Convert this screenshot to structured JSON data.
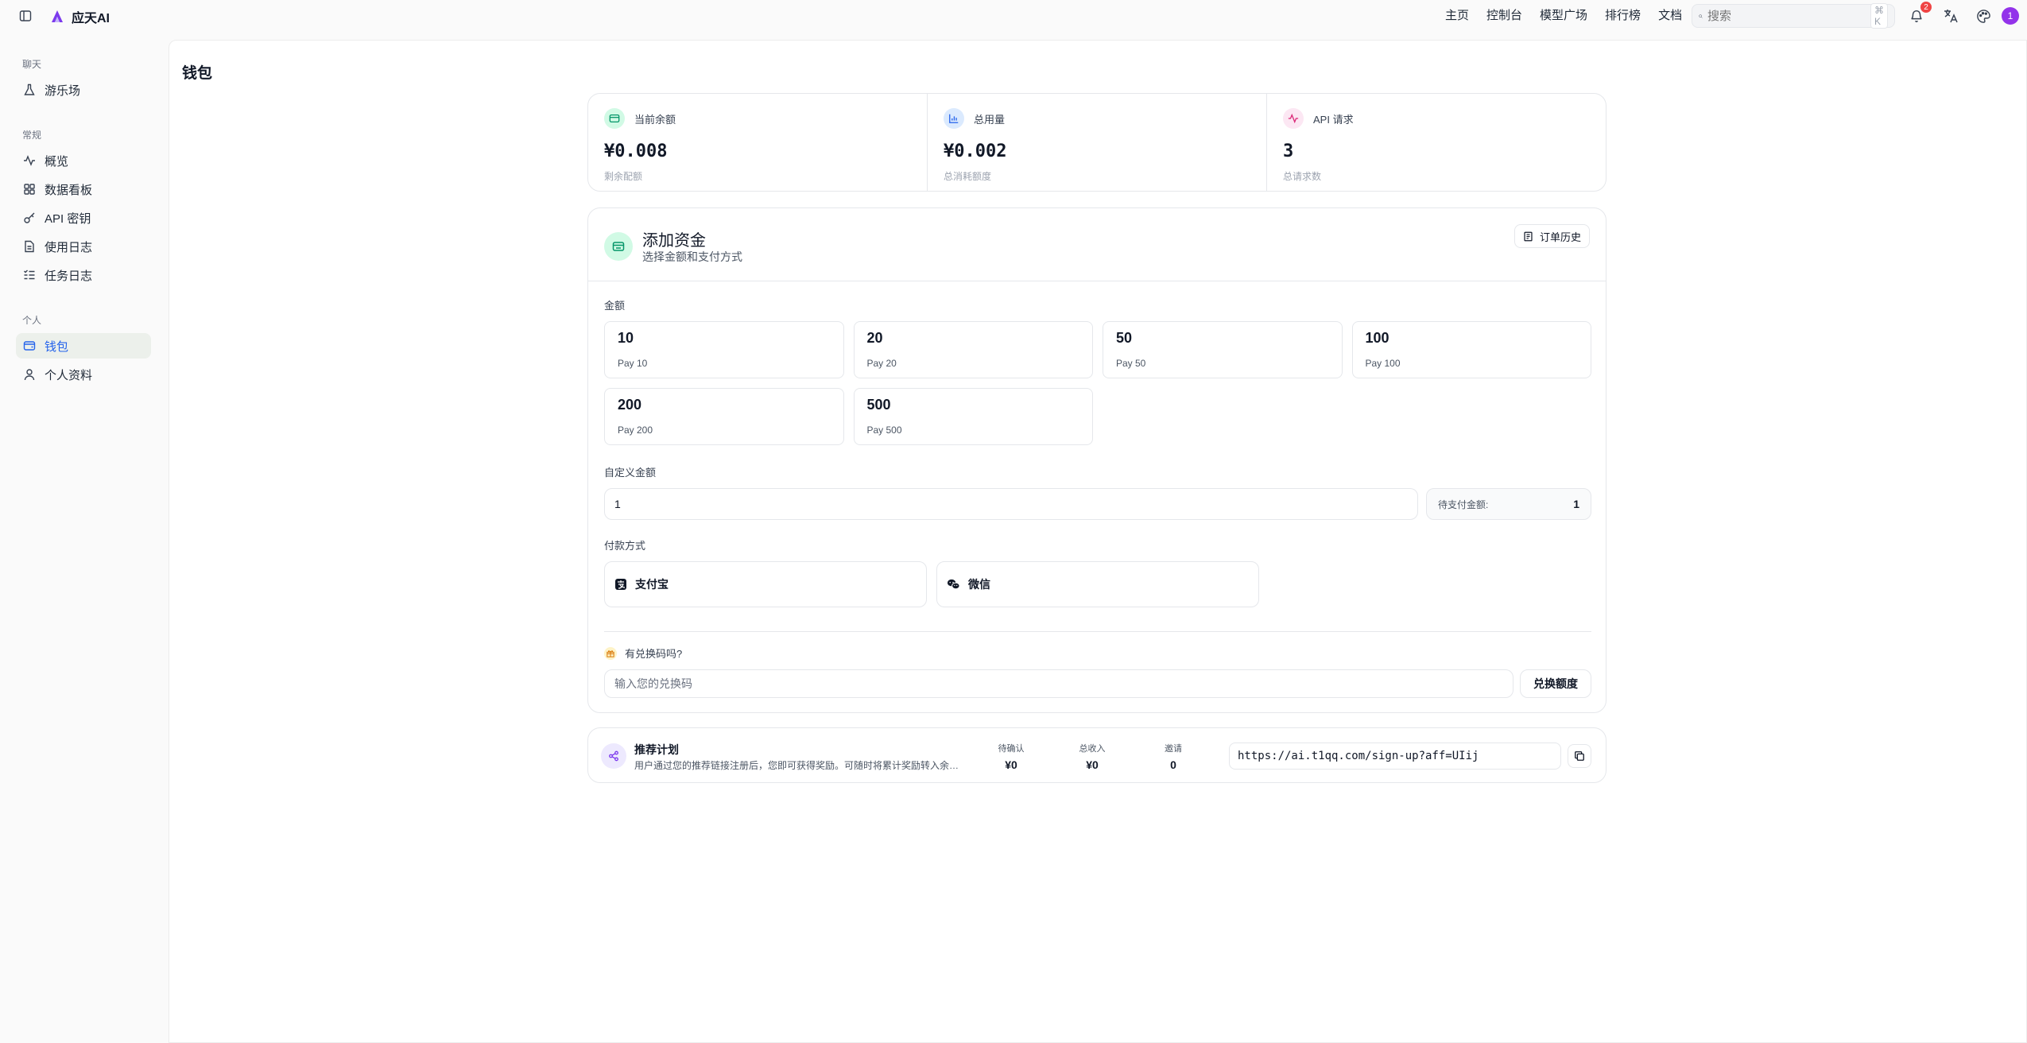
{
  "app": {
    "brand": "应天AI"
  },
  "topnav": {
    "items": [
      "主页",
      "控制台",
      "模型广场",
      "排行榜",
      "文档"
    ],
    "search_placeholder": "搜索",
    "search_shortcut": "⌘ K",
    "notification_count": "2",
    "avatar_letter": "1"
  },
  "sidebar": {
    "sections": [
      {
        "title": "聊天",
        "items": [
          {
            "label": "游乐场",
            "icon": "flask-icon"
          }
        ]
      },
      {
        "title": "常规",
        "items": [
          {
            "label": "概览",
            "icon": "activity-icon"
          },
          {
            "label": "数据看板",
            "icon": "dashboard-icon"
          },
          {
            "label": "API 密钥",
            "icon": "key-icon"
          },
          {
            "label": "使用日志",
            "icon": "file-text-icon"
          },
          {
            "label": "任务日志",
            "icon": "list-check-icon"
          }
        ]
      },
      {
        "title": "个人",
        "items": [
          {
            "label": "钱包",
            "icon": "wallet-icon",
            "active": true
          },
          {
            "label": "个人资料",
            "icon": "user-icon"
          }
        ]
      }
    ]
  },
  "page": {
    "title": "钱包"
  },
  "stats": [
    {
      "label": "当前余额",
      "value": "¥0.008",
      "sub": "剩余配额",
      "icon": "wallet-icon",
      "color": "#059669",
      "bg": "#d1fae5"
    },
    {
      "label": "总用量",
      "value": "¥0.002",
      "sub": "总消耗额度",
      "icon": "bar-chart-icon",
      "color": "#2563eb",
      "bg": "#dbeafe"
    },
    {
      "label": "API 请求",
      "value": "3",
      "sub": "总请求数",
      "icon": "activity-icon",
      "color": "#db2777",
      "bg": "#fce7f3"
    }
  ],
  "funds": {
    "title": "添加资金",
    "subtitle": "选择金额和支付方式",
    "order_history": "订单历史",
    "amount_label": "金额",
    "amounts": [
      {
        "value": "10",
        "pay": "Pay 10"
      },
      {
        "value": "20",
        "pay": "Pay 20"
      },
      {
        "value": "50",
        "pay": "Pay 50"
      },
      {
        "value": "100",
        "pay": "Pay 100"
      },
      {
        "value": "200",
        "pay": "Pay 200"
      },
      {
        "value": "500",
        "pay": "Pay 500"
      }
    ],
    "custom_label": "自定义金额",
    "custom_value": "1",
    "pending_label": "待支付金额:",
    "pending_value": "1",
    "payment_label": "付款方式",
    "payment_methods": [
      {
        "label": "支付宝",
        "icon": "alipay-icon"
      },
      {
        "label": "微信",
        "icon": "wechat-icon"
      }
    ],
    "redeem_label": "有兑换码吗?",
    "redeem_placeholder": "输入您的兑换码",
    "redeem_button": "兑换额度"
  },
  "referral": {
    "title": "推荐计划",
    "description": "用户通过您的推荐链接注册后，您即可获得奖励。可随时将累计奖励转入余…",
    "stats": [
      {
        "label": "待确认",
        "value": "¥0"
      },
      {
        "label": "总收入",
        "value": "¥0"
      },
      {
        "label": "邀请",
        "value": "0"
      }
    ],
    "link": "https://ai.t1qq.com/sign-up?aff=UIij"
  }
}
